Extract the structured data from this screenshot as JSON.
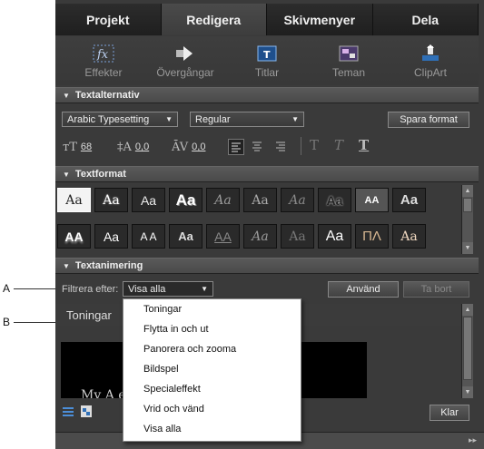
{
  "callouts": [
    {
      "label": "A"
    },
    {
      "label": "B"
    }
  ],
  "tabs": [
    {
      "label": "Projekt"
    },
    {
      "label": "Redigera"
    },
    {
      "label": "Skivmenyer"
    },
    {
      "label": "Dela"
    }
  ],
  "active_tab": "Redigera",
  "toolbar": [
    {
      "label": "Effekter",
      "icon": "fx-icon"
    },
    {
      "label": "Övergångar",
      "icon": "transition-arrow-icon"
    },
    {
      "label": "Titlar",
      "icon": "titles-icon"
    },
    {
      "label": "Teman",
      "icon": "themes-icon"
    },
    {
      "label": "ClipArt",
      "icon": "clipart-icon"
    }
  ],
  "textalternativ": {
    "header": "Textalternativ",
    "font": "Arabic Typesetting",
    "style": "Regular",
    "save_button": "Spara format",
    "size_value": "68",
    "leading_value": "0,0",
    "kerning_value": "0,0",
    "style_buttons": [
      "T",
      "T",
      "T"
    ]
  },
  "textformat": {
    "header": "Textformat",
    "swatches": [
      "Aa",
      "Aa",
      "Aa",
      "Aa",
      "Aa",
      "Aa",
      "Aa",
      "Aa",
      "AA",
      "Aa",
      "AA",
      "Aa",
      "A A",
      "Aa",
      "AA",
      "Aa",
      "Aa",
      "Aa",
      "ΠΛ",
      "Aa"
    ]
  },
  "textanimering": {
    "header": "Textanimering",
    "filter_label": "Filtrera efter:",
    "filter_value": "Visa alla",
    "apply_button": "Använd",
    "remove_button": "Ta bort",
    "category_tab": "Toningar",
    "preview_text": "My A                              ed"
  },
  "dropdown_menu": {
    "items": [
      "Toningar",
      "Flytta in och ut",
      "Panorera och zooma",
      "Bildspel",
      "Specialeffekt",
      "Vrid och vänd",
      "Visa alla"
    ]
  },
  "done_button": "Klar",
  "colors": {
    "panel_bg": "#3a3a3a",
    "section_header": "#4e4e4e",
    "menu_bg": "#ffffff"
  }
}
